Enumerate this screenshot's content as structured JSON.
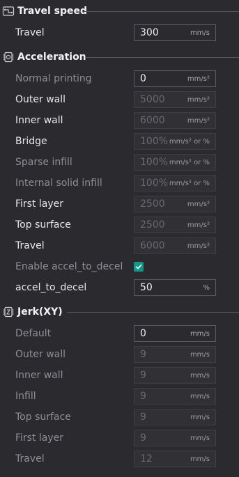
{
  "sections": [
    {
      "title": "Travel speed",
      "icon": "travel-speed-icon",
      "rows": [
        {
          "label": "Travel",
          "value": "300",
          "unit": "mm/s",
          "state": "active"
        }
      ]
    },
    {
      "title": "Acceleration",
      "icon": "acceleration-icon",
      "rows": [
        {
          "label": "Normal printing",
          "value": "0",
          "unit": "mm/s²",
          "state": "active"
        },
        {
          "label": "Outer wall",
          "value": "5000",
          "unit": "mm/s²",
          "state": "disabled"
        },
        {
          "label": "Inner wall",
          "value": "6000",
          "unit": "mm/s²",
          "state": "disabled"
        },
        {
          "label": "Bridge",
          "value": "100%",
          "unit": "mm/s² or %",
          "state": "disabled"
        },
        {
          "label": "Sparse infill",
          "value": "100%",
          "unit": "mm/s² or %",
          "state": "disabled"
        },
        {
          "label": "Internal solid infill",
          "value": "100%",
          "unit": "mm/s² or %",
          "state": "disabled"
        },
        {
          "label": "First layer",
          "value": "2500",
          "unit": "mm/s²",
          "state": "disabled"
        },
        {
          "label": "Top surface",
          "value": "2500",
          "unit": "mm/s²",
          "state": "disabled"
        },
        {
          "label": "Travel",
          "value": "6000",
          "unit": "mm/s²",
          "state": "disabled"
        },
        {
          "label": "Enable accel_to_decel",
          "type": "checkbox",
          "checked": true
        },
        {
          "label": "accel_to_decel",
          "value": "50",
          "unit": "%",
          "state": "active"
        }
      ]
    },
    {
      "title": "Jerk(XY)",
      "icon": "jerk-icon",
      "rows": [
        {
          "label": "Default",
          "value": "0",
          "unit": "mm/s",
          "state": "active"
        },
        {
          "label": "Outer wall",
          "value": "9",
          "unit": "mm/s",
          "state": "disabled"
        },
        {
          "label": "Inner wall",
          "value": "9",
          "unit": "mm/s",
          "state": "disabled"
        },
        {
          "label": "Infill",
          "value": "9",
          "unit": "mm/s",
          "state": "disabled"
        },
        {
          "label": "Top surface",
          "value": "9",
          "unit": "mm/s",
          "state": "disabled"
        },
        {
          "label": "First layer",
          "value": "9",
          "unit": "mm/s",
          "state": "disabled"
        },
        {
          "label": "Travel",
          "value": "12",
          "unit": "mm/s",
          "state": "disabled"
        }
      ]
    }
  ],
  "colors": {
    "background": "#2b2b2f",
    "accent": "#15968a",
    "divider": "#55555a"
  }
}
